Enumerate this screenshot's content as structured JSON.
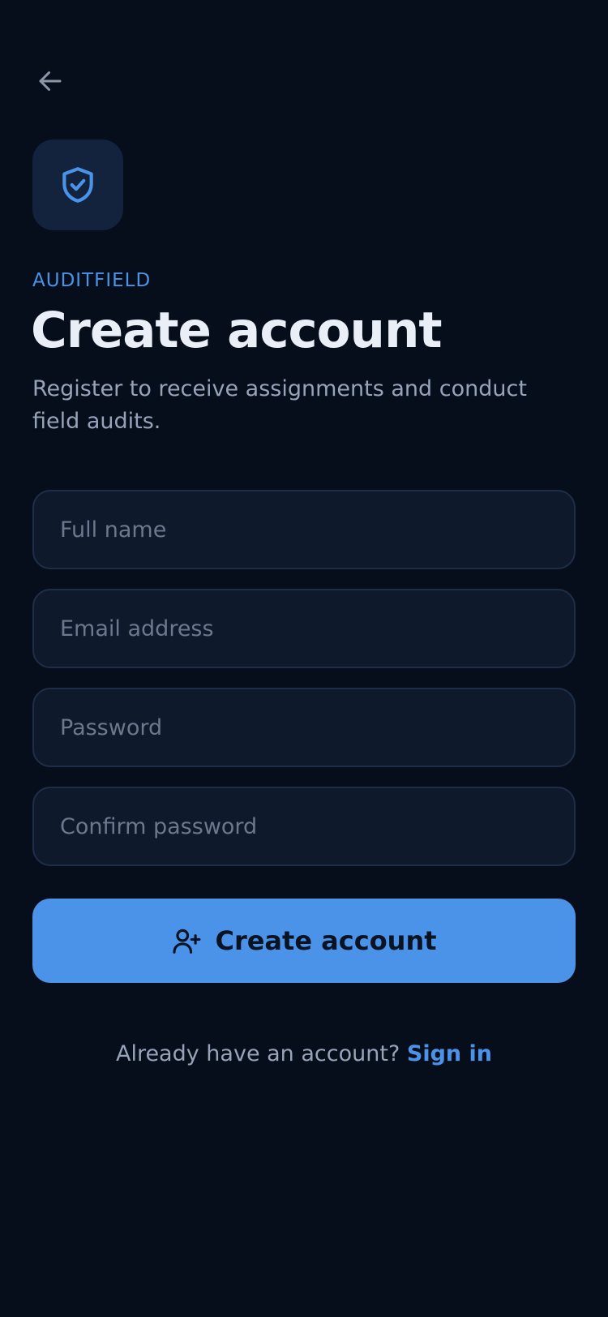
{
  "header": {
    "back_icon": "arrow-left-icon",
    "logo_icon": "shield-check-icon"
  },
  "brand": {
    "name": "AUDITFIELD"
  },
  "page": {
    "title": "Create account",
    "subtitle": "Register to receive assignments and conduct field audits."
  },
  "form": {
    "full_name_placeholder": "Full name",
    "email_placeholder": "Email address",
    "password_placeholder": "Password",
    "confirm_password_placeholder": "Confirm password",
    "submit_label": "Create account",
    "submit_icon": "user-plus-icon"
  },
  "footer": {
    "prompt": "Already have an account?",
    "link_label": "Sign in"
  },
  "colors": {
    "background": "#070E1B",
    "accent": "#4B93E8",
    "field_bg": "#0E1A2C",
    "field_border": "#1F2E47",
    "text_primary": "#E9EEF7",
    "text_secondary": "#96A3B8",
    "placeholder": "#6B788D"
  }
}
